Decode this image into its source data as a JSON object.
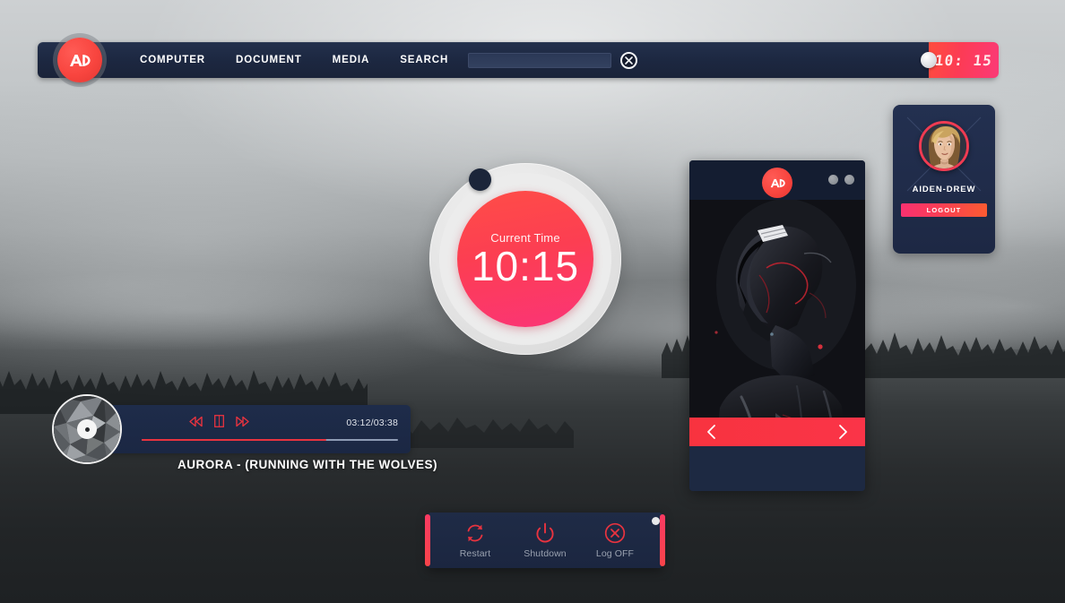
{
  "brand": {
    "logo_text": "AD",
    "accent": "#f8333f",
    "accent_pink": "#fb3a77",
    "navy": "#1d2942"
  },
  "taskbar": {
    "nav_items": [
      {
        "label": "COMPUTER",
        "name": "nav-item-computer"
      },
      {
        "label": "DOCUMENT",
        "name": "nav-item-document"
      },
      {
        "label": "MEDIA",
        "name": "nav-item-media"
      },
      {
        "label": "SEARCH",
        "name": "nav-item-search"
      }
    ],
    "search": {
      "value": "",
      "placeholder": ""
    },
    "clear_icon": "close-x-icon",
    "clock": "10: 15"
  },
  "clock_widget": {
    "label": "Current Time",
    "time": "10:15"
  },
  "music_player": {
    "controls": [
      {
        "label": "Rewind",
        "name": "rewind-button"
      },
      {
        "label": "Pause",
        "name": "pause-button"
      },
      {
        "label": "Fast forward",
        "name": "forward-button"
      }
    ],
    "elapsed": "03:12",
    "duration": "03:38",
    "time_display": "03:12/03:38",
    "progress_percent": 72,
    "song_title": "AURORA - (RUNNING WITH THE WOLVES)"
  },
  "media_panel": {
    "logo_text": "AD",
    "window_dots": 2,
    "prev_label": "Previous",
    "next_label": "Next"
  },
  "user_panel": {
    "username": "AIDEN-DREW",
    "logout_label": "LOGOUT"
  },
  "power_menu": {
    "items": [
      {
        "label": "Restart",
        "icon": "restart-icon",
        "name": "power-item-restart"
      },
      {
        "label": "Shutdown",
        "icon": "power-icon",
        "name": "power-item-shutdown"
      },
      {
        "label": "Log OFF",
        "icon": "logoff-x-icon",
        "name": "power-item-logoff"
      }
    ]
  }
}
